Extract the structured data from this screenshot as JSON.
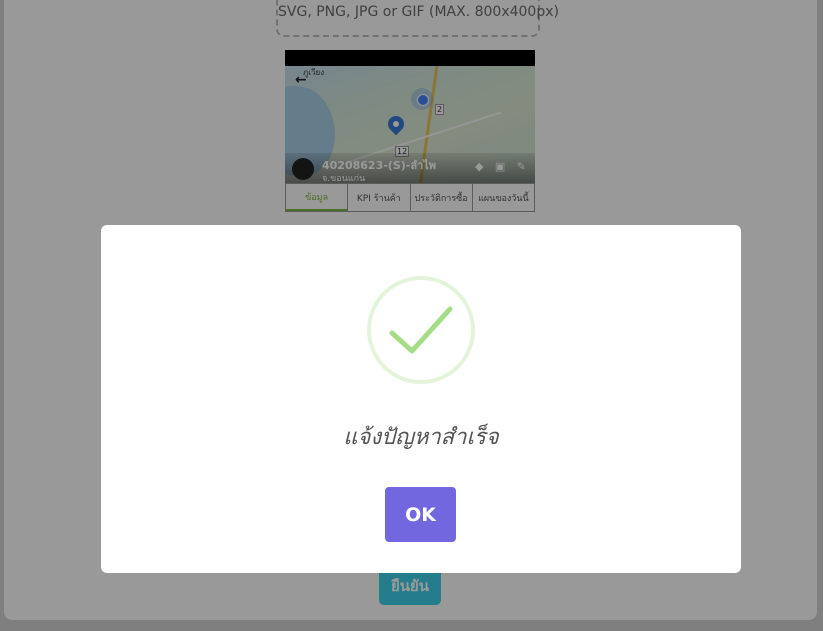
{
  "page": {
    "dropzone_hint": "SVG, PNG, JPG or GIF (MAX. 800x400px)",
    "preview": {
      "map_label_a": "ภูเวียง",
      "map_label_b": "2",
      "map_label_c": "12",
      "store_title": "40208623-(S)-ลำไพ",
      "store_subtitle": "จ.ขอนแก่น",
      "actions": "◆ ▣ ✎",
      "tabs": [
        "ข้อมูล",
        "KPI ร้านค้า",
        "ประวัติการซื้อ",
        "แผนของวันนี้"
      ]
    },
    "confirm_label": "ยืนยัน"
  },
  "modal": {
    "title": "แจ้งปัญหาสำเร็จ",
    "ok_label": "OK",
    "icon": "success-check-icon",
    "colors": {
      "check": "#a5dc86",
      "ring": "rgba(165,220,134,0.3)",
      "button": "#7367e0"
    }
  }
}
